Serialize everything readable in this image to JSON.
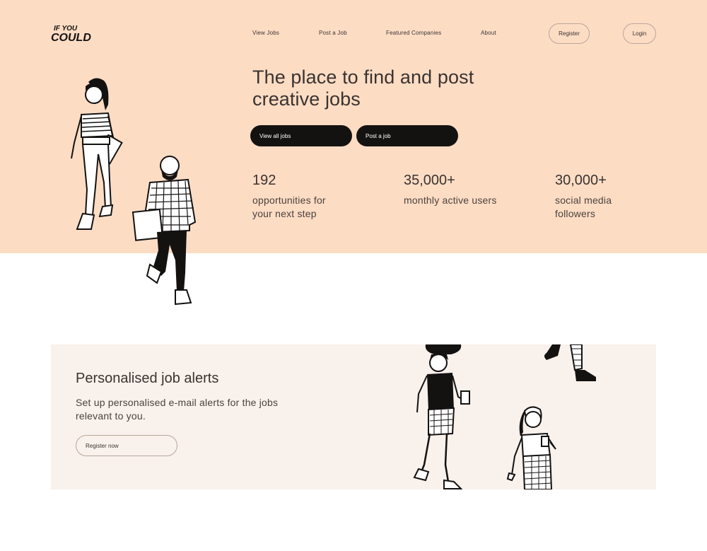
{
  "brand": {
    "logo_text_line1": "IF YOU",
    "logo_text_line2": "COULD"
  },
  "nav": {
    "links": [
      "View Jobs",
      "Post a Job",
      "Featured Companies",
      "About"
    ],
    "register": "Register",
    "login": "Login"
  },
  "hero": {
    "headline_line1": "The place to find and post",
    "headline_line2": "creative jobs",
    "buttons": [
      "View all jobs",
      "Post a job"
    ],
    "stats": [
      {
        "value": "192",
        "label_line1": "opportunities for",
        "label_line2": "your next step"
      },
      {
        "value": "35,000+",
        "label_line1": "monthly active users",
        "label_line2": ""
      },
      {
        "value": "30,000+",
        "label_line1": "social media",
        "label_line2": "followers"
      }
    ]
  },
  "alerts": {
    "title": "Personalised job alerts",
    "desc_line1": "Set up personalised e-mail alerts for the jobs",
    "desc_line2": "relevant to you.",
    "button": "Register now"
  },
  "colors": {
    "hero_bg": "#fddcc4",
    "alerts_bg": "#f8f1ec",
    "button_dark": "#141211"
  },
  "illustrations": [
    "walking-woman-illustration",
    "walking-man-illustration",
    "woman-with-coffee-illustration",
    "woman-with-phone-illustration",
    "legs-illustration"
  ]
}
